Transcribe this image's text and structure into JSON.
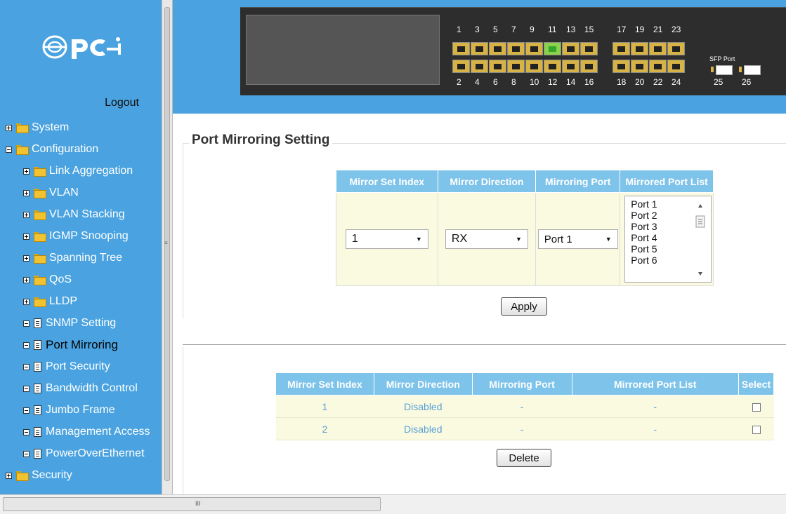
{
  "sidebar": {
    "logout": "Logout",
    "items": [
      {
        "label": "System",
        "type": "folder",
        "expand": "plus",
        "indent": 0
      },
      {
        "label": "Configuration",
        "type": "folder",
        "expand": "minus",
        "indent": 0
      },
      {
        "label": "Link Aggregation",
        "type": "folder",
        "expand": "plus",
        "indent": 1
      },
      {
        "label": "VLAN",
        "type": "folder",
        "expand": "plus",
        "indent": 1
      },
      {
        "label": "VLAN Stacking",
        "type": "folder",
        "expand": "plus",
        "indent": 1
      },
      {
        "label": "IGMP Snooping",
        "type": "folder",
        "expand": "plus",
        "indent": 1
      },
      {
        "label": "Spanning Tree",
        "type": "folder",
        "expand": "plus",
        "indent": 1
      },
      {
        "label": "QoS",
        "type": "folder",
        "expand": "plus",
        "indent": 1
      },
      {
        "label": "LLDP",
        "type": "folder",
        "expand": "plus",
        "indent": 1
      },
      {
        "label": "SNMP Setting",
        "type": "page",
        "expand": "minus",
        "indent": 1
      },
      {
        "label": "Port Mirroring",
        "type": "page",
        "expand": "minus",
        "indent": 1,
        "active": true
      },
      {
        "label": "Port Security",
        "type": "page",
        "expand": "minus",
        "indent": 1
      },
      {
        "label": "Bandwidth Control",
        "type": "page",
        "expand": "minus",
        "indent": 1
      },
      {
        "label": "Jumbo Frame",
        "type": "page",
        "expand": "minus",
        "indent": 1
      },
      {
        "label": "Management Access",
        "type": "page",
        "expand": "minus",
        "indent": 1
      },
      {
        "label": "PowerOverEthernet",
        "type": "page",
        "expand": "minus",
        "indent": 1
      },
      {
        "label": "Security",
        "type": "folder",
        "expand": "plus",
        "indent": 0
      }
    ]
  },
  "switch": {
    "top_numbers": [
      "1",
      "3",
      "5",
      "7",
      "9",
      "11",
      "13",
      "15",
      "17",
      "19",
      "21",
      "23"
    ],
    "bottom_numbers": [
      "2",
      "4",
      "6",
      "8",
      "10",
      "12",
      "14",
      "16",
      "18",
      "20",
      "22",
      "24",
      "25",
      "26"
    ],
    "sfp_label": "SFP Port",
    "link_up_port": "11"
  },
  "form": {
    "title": "Port Mirroring Setting",
    "headers": [
      "Mirror Set Index",
      "Mirror Direction",
      "Mirroring Port",
      "Mirrored Port List"
    ],
    "index_value": "1",
    "direction_value": "RX",
    "mirroring_port_value": "Port 1",
    "port_list": [
      "Port 1",
      "Port 2",
      "Port 3",
      "Port 4",
      "Port 5",
      "Port 6"
    ],
    "apply_label": "Apply"
  },
  "table": {
    "headers": [
      "Mirror Set Index",
      "Mirror Direction",
      "Mirroring Port",
      "Mirrored Port List",
      "Select"
    ],
    "rows": [
      {
        "index": "1",
        "direction": "Disabled",
        "port": "-",
        "list": "-"
      },
      {
        "index": "2",
        "direction": "Disabled",
        "port": "-",
        "list": "-"
      }
    ],
    "delete_label": "Delete"
  },
  "colors": {
    "header_blue": "#4aa3e0",
    "table_header": "#7ec3ea",
    "row_bg": "#fafae1",
    "link_text": "#5aa0d6"
  }
}
